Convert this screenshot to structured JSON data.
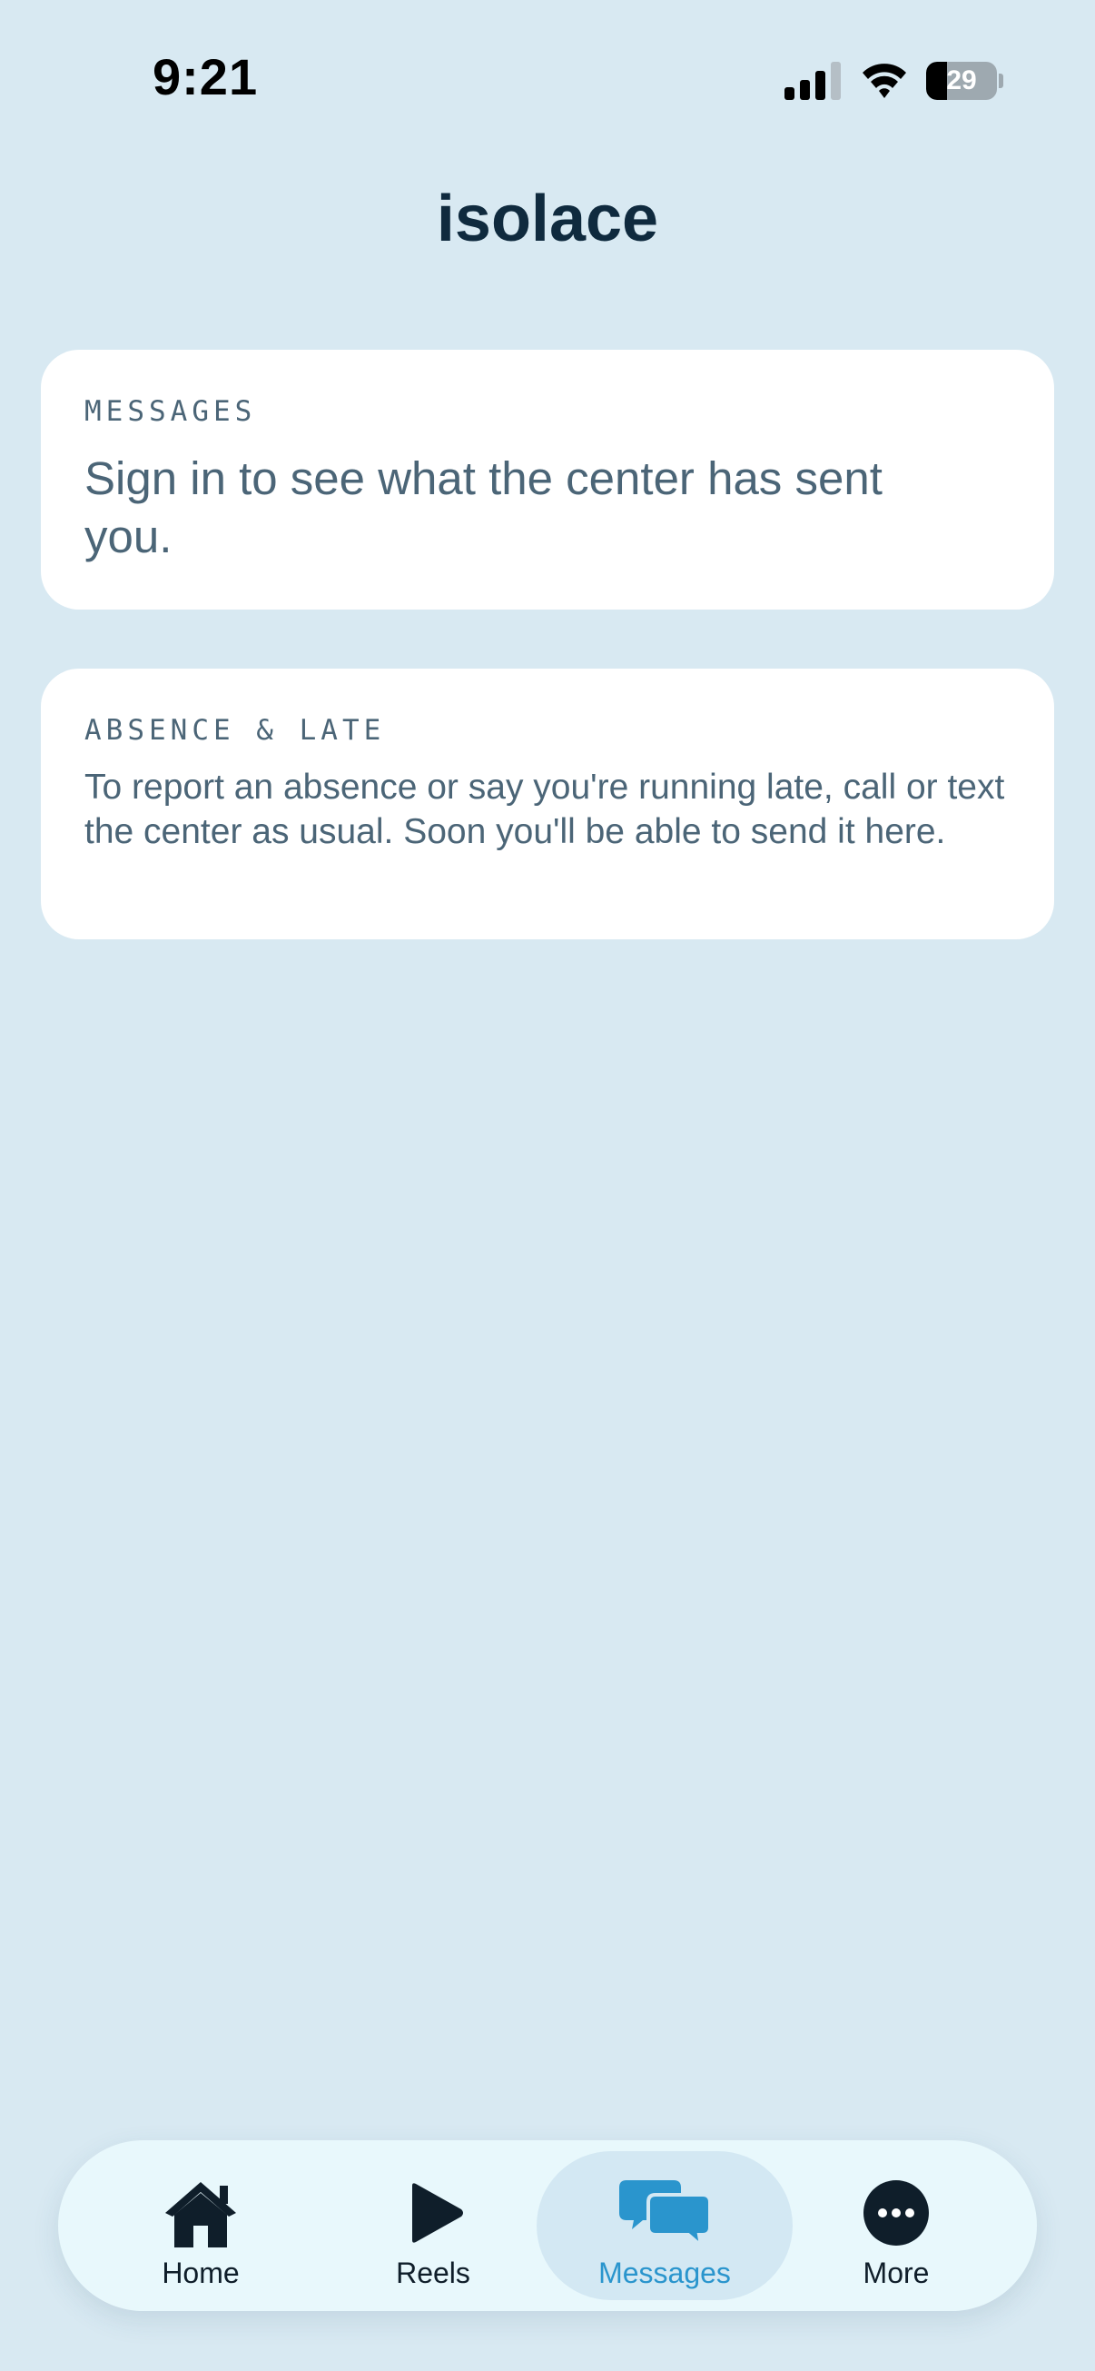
{
  "status_bar": {
    "time": "9:21",
    "battery_level": "29",
    "battery_fraction": 0.29
  },
  "header": {
    "title": "isolace"
  },
  "cards": {
    "messages": {
      "label": "MESSAGES",
      "body": "Sign in to see what the center has sent you."
    },
    "absence": {
      "label": "ABSENCE & LATE",
      "body": "To report an absence or say you're running late, call or text the center as usual. Soon you'll be able to send it here."
    }
  },
  "tab_bar": {
    "active": "messages",
    "items": [
      {
        "id": "home",
        "label": "Home",
        "icon": "home-icon"
      },
      {
        "id": "reels",
        "label": "Reels",
        "icon": "play-icon"
      },
      {
        "id": "messages",
        "label": "Messages",
        "icon": "chat-bubbles-icon"
      },
      {
        "id": "more",
        "label": "More",
        "icon": "more-dots-icon"
      }
    ]
  },
  "colors": {
    "background": "#d8e9f2",
    "accent": "#2a95cd",
    "title": "#0f2a3e",
    "muted_text": "#4b6577"
  }
}
